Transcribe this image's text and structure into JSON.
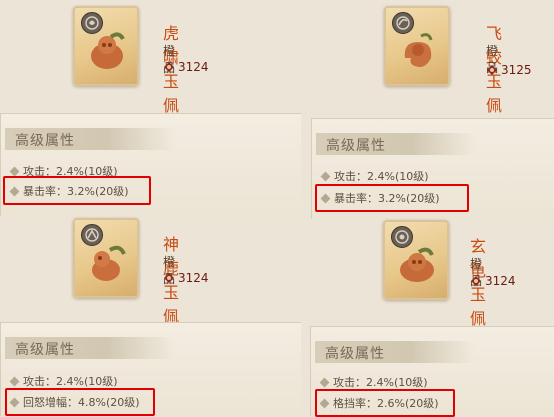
{
  "items": [
    {
      "name": "虎啸玉佩",
      "grade": "橙品",
      "price": "3124",
      "section_title": "高级属性",
      "attack": "攻击：2.4%(10级)",
      "special": "暴击率：3.2%(20级)"
    },
    {
      "name": "飞蛟玉佩",
      "grade": "橙品",
      "price": "3125",
      "section_title": "高级属性",
      "attack": "攻击：2.4%(10级)",
      "special": "暴击率：3.2%(20级)"
    },
    {
      "name": "神鹿玉佩",
      "grade": "橙品",
      "price": "3124",
      "section_title": "高级属性",
      "attack": "攻击：2.4%(10级)",
      "special": "回怒增幅：4.8%(20级)"
    },
    {
      "name": "玄龟玉佩",
      "grade": "橙品",
      "price": "3124",
      "section_title": "高级属性",
      "attack": "攻击：2.4%(10级)",
      "special": "格挡率：2.6%(20级)"
    }
  ],
  "colors": {
    "name": "#c94b12",
    "highlight": "#e00000",
    "background": "#ece4d6"
  },
  "icons": {
    "badge": "emblem-icon",
    "price": "currency-icon"
  }
}
